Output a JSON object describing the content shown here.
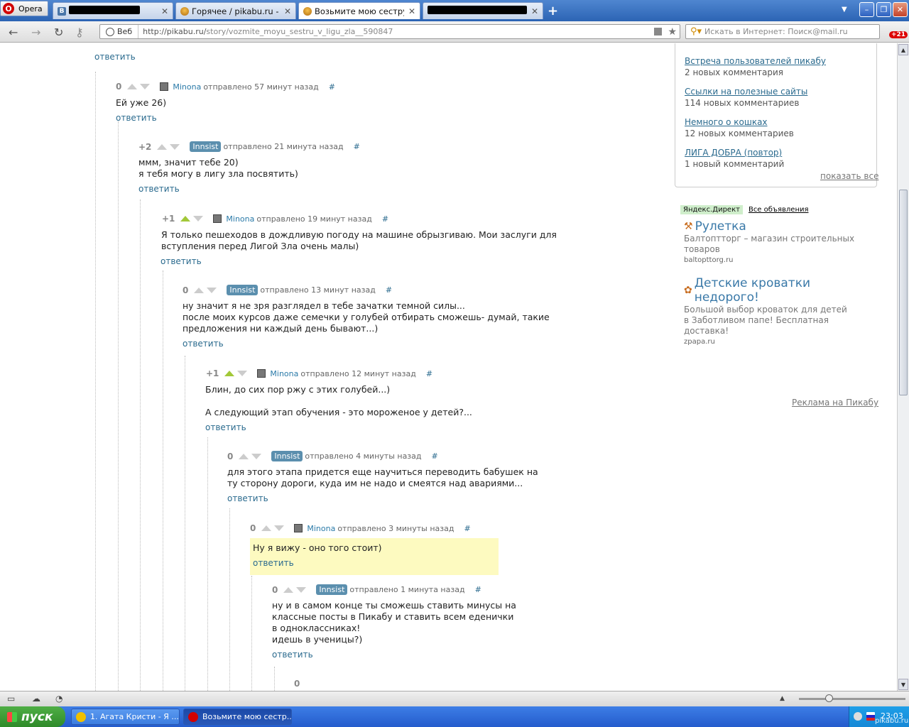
{
  "browser": {
    "menu_label": "Opera",
    "tabs": [
      {
        "title": "",
        "favicon": "vk-icon",
        "redacted": true
      },
      {
        "title": "Горячее / pikabu.ru - Все",
        "favicon": "pikabu-icon",
        "redacted": false
      },
      {
        "title": "Возьмите мою сестру в ...",
        "favicon": "pikabu-icon",
        "redacted": false,
        "active": true
      },
      {
        "title": "",
        "favicon": "none",
        "redacted": true
      }
    ],
    "address_mode": "Веб",
    "url_host": "http://pikabu.ru/",
    "url_path": "story/vozmite_moyu_sestru_v_ligu_zla__590847",
    "search_placeholder": "Искать в Интернет: Поиск@mail.ru",
    "badge": "+21"
  },
  "thread": {
    "top_reply": "ответить",
    "comments": [
      {
        "score": "0",
        "up": false,
        "user": "Minona",
        "style": "avatar",
        "time": "отправлено 57 минут назад",
        "hash": "#",
        "text": "Ей уже 26)",
        "reply": "ответить"
      },
      {
        "score": "+2",
        "up": false,
        "user": "Innsist",
        "style": "badge",
        "time": "отправлено 21 минута назад",
        "hash": "#",
        "text": "ммм, значит тебе 20)\nя тебя могу в лигу зла посвятить)",
        "reply": "ответить"
      },
      {
        "score": "+1",
        "up": true,
        "user": "Minona",
        "style": "avatar",
        "time": "отправлено 19 минут назад",
        "hash": "#",
        "text": "Я только пешеходов в дождливую погоду на машине обрызгиваю. Мои заслуги для\nвступления перед Лигой Зла очень малы)",
        "reply": "ответить"
      },
      {
        "score": "0",
        "up": false,
        "user": "Innsist",
        "style": "badge",
        "time": "отправлено 13 минут назад",
        "hash": "#",
        "text": "ну значит я не зря разглядел в тебе зачатки темной силы...\nпосле моих курсов даже семечки у голубей отбирать сможешь- думай, такие\nпредложения ни каждый день бывают...)",
        "reply": "ответить"
      },
      {
        "score": "+1",
        "up": true,
        "user": "Minona",
        "style": "avatar",
        "time": "отправлено 12 минут назад",
        "hash": "#",
        "text": "Блин, до сих пор ржу с этих голубей...)\n\nА следующий этап обучения - это мороженое у детей?...",
        "reply": "ответить"
      },
      {
        "score": "0",
        "up": false,
        "user": "Innsist",
        "style": "badge",
        "time": "отправлено 4 минуты назад",
        "hash": "#",
        "text": "для этого этапа придется еще научиться переводить бабушек на\nту сторону дороги, куда им не надо и смеятся над авариями...",
        "reply": "ответить"
      },
      {
        "score": "0",
        "up": false,
        "user": "Minona",
        "style": "avatar",
        "time": "отправлено 3 минуты назад",
        "hash": "#",
        "text": "Ну я вижу - оно того стоит)",
        "reply": "ответить",
        "highlight": true
      },
      {
        "score": "0",
        "up": false,
        "user": "Innsist",
        "style": "badge",
        "time": "отправлено 1 минута назад",
        "hash": "#",
        "text": "ну и в самом конце ты сможешь ставить минусы на\nклассные посты в Пикабу и ставить всем еденички\nв одноклассниках!\nидешь в ученицы?)",
        "reply": "ответить"
      },
      {
        "score": "0"
      }
    ]
  },
  "sidebar": {
    "items": [
      {
        "title": "Встреча пользователей пикабу",
        "count": "2 новых комментария"
      },
      {
        "title": "Ссылки на полезные сайты",
        "count": "114 новых комментариев"
      },
      {
        "title": "Немного о кошках",
        "count": "12 новых комментариев"
      },
      {
        "title": "ЛИГА ДОБРА (повтор)",
        "count": "1 новый комментарий"
      }
    ],
    "show_all": "показать все",
    "direct_label": "Яндекс.Директ",
    "all_ads": "Все объявления",
    "ads": [
      {
        "title": "Рулетка",
        "desc": "Балтоптторг – магазин строительных\nтоваров",
        "url": "baltopttorg.ru"
      },
      {
        "title": "Детские кроватки недорого!",
        "desc": "Большой выбор кроваток для детей\nв Заботливом папе! Бесплатная доставка!",
        "url": "zpapa.ru"
      }
    ],
    "ad_link": "Реклама на Пикабу"
  },
  "taskbar": {
    "start": "пуск",
    "buttons": [
      {
        "label": "1. Агата Кристи - Я ...",
        "active": false
      },
      {
        "label": "Возьмите мою сестр...",
        "active": true
      }
    ],
    "clock": "23:03"
  }
}
